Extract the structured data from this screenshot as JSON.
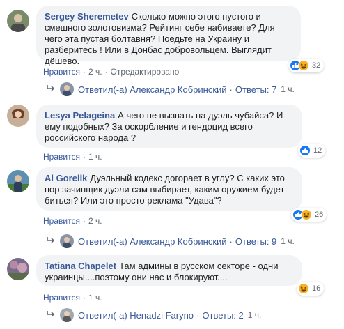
{
  "comments": [
    {
      "author": "Sergey Sheremetev",
      "text": "Сколько можно этого пустого и смешного золотовизма? Рейтинг себе набиваете? Для чего эта пустая болтавня? Поедьте на Украину и разберитесь ! Или в Донбас добровольцем. Выглядит дёшево.",
      "like": "Нравится",
      "time": "2 ч.",
      "edited": "Отредактировано",
      "reactions_count": "32",
      "reply": {
        "label": "Ответил(-а) Александр Кобринский",
        "count": "Ответы: 7",
        "time": "1 ч."
      }
    },
    {
      "author": "Lesya Pelageina",
      "text": "А чего не вызвать на дуэль чубайса? И ему подобных? За оскорбление и гендоцид всего российского народа ?",
      "like": "Нравится",
      "time": "1 ч.",
      "reactions_count": "12"
    },
    {
      "author": "Al Gorelik",
      "text": "Дуэльный кодекс догорает в углу? С каких это пор зачинщик дуэли сам выбирает, каким оружием будет биться? Или это просто реклама \"Удава\"?",
      "like": "Нравится",
      "time": "2 ч.",
      "reactions_count": "26",
      "reply": {
        "label": "Ответил(-а) Александр Кобринский",
        "count": "Ответы: 9",
        "time": "1 ч."
      }
    },
    {
      "author": "Tatiana Chapelet",
      "text": "Там админы в русском секторе - одни украинцы....поэтому они нас и блокируют....",
      "like": "Нравится",
      "time": "1 ч.",
      "reactions_count": "16",
      "reply": {
        "label": "Ответил(-а) Henadzi Faryno",
        "count": "Ответы: 2",
        "time": "1 ч."
      }
    }
  ],
  "icons": {
    "like": "like-reaction-icon",
    "haha": "haha-reaction-icon",
    "reply": "reply-arrow-icon"
  },
  "colors": {
    "link": "#385898",
    "bubble": "#f2f3f5",
    "meta": "#606770",
    "like": "#1877f2",
    "haha": "#f7b125"
  }
}
